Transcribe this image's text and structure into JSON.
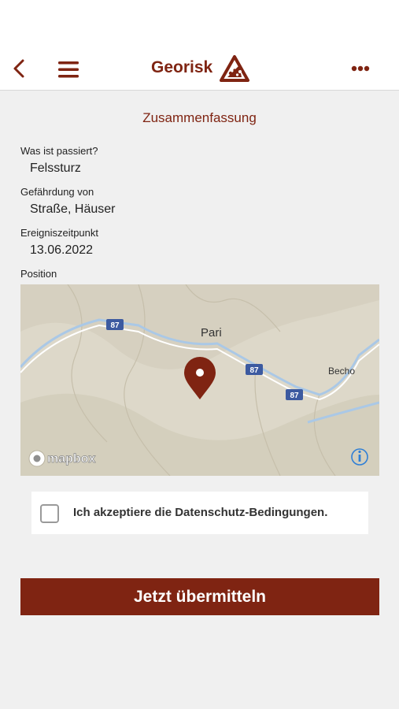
{
  "header": {
    "title": "Georisk",
    "back_icon": "chevron-left-icon",
    "menu_icon": "hamburger-icon",
    "more_icon": "more-horizontal-icon",
    "logo_icon": "rockfall-warning-icon"
  },
  "summary": {
    "title": "Zusammenfassung",
    "what_label": "Was ist passiert?",
    "what_value": "Felssturz",
    "hazard_label": "Gefährdung von",
    "hazard_value": "Straße, Häuser",
    "time_label": "Ereigniszeitpunkt",
    "time_value": "13.06.2022",
    "position_label": "Position"
  },
  "map": {
    "places": [
      "Pari",
      "Becho"
    ],
    "road_shields": [
      "87",
      "87",
      "87"
    ],
    "attribution": "mapbox",
    "info_icon": "info-icon",
    "marker_icon": "map-pin-icon"
  },
  "consent": {
    "label": "Ich akzeptiere die Datenschutz-Bedingungen.",
    "checked": false
  },
  "actions": {
    "submit_label": "Jetzt übermitteln"
  },
  "colors": {
    "brand": "#7f2412",
    "background": "#f0f0f0",
    "map_water": "#aac8e6"
  }
}
